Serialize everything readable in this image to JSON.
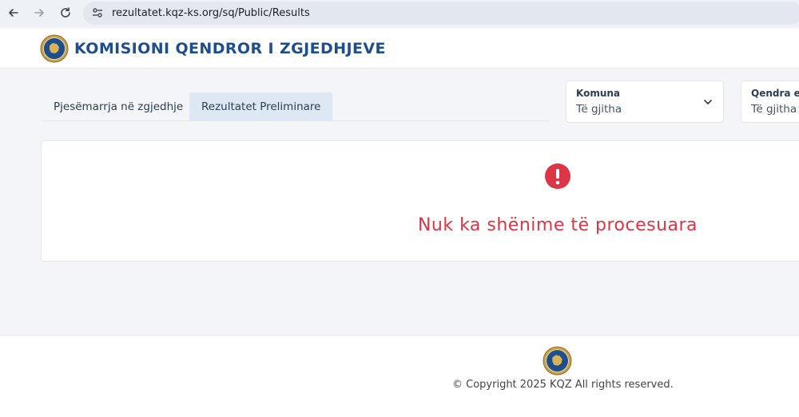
{
  "browser": {
    "url": "rezultatet.kqz-ks.org/sq/Public/Results",
    "icons": [
      "arrow-left-icon",
      "arrow-right-icon",
      "reload-icon",
      "site-info-icon"
    ]
  },
  "header": {
    "title": "KOMISIONI QENDROR I ZGJEDHJEVE",
    "logo": "kqz-seal-logo"
  },
  "tabs": [
    {
      "label": "Pjesëmarrja në zgjedhje",
      "active": false
    },
    {
      "label": "Rezultatet Preliminare",
      "active": true
    }
  ],
  "filters": [
    {
      "label": "Komuna",
      "value": "Të gjitha"
    },
    {
      "label": "Qendra e v",
      "value": "Të gjitha"
    }
  ],
  "results": {
    "message": "Nuk ka shënime të procesuara",
    "icon": "exclamation-circle-icon",
    "color": "#dc3545"
  },
  "footer": {
    "copyright": "© Copyright 2025 KQZ All rights reserved."
  },
  "colors": {
    "brand": "#1f4e8c",
    "tab_active_bg": "#dde8f5",
    "error": "#dc3545"
  }
}
